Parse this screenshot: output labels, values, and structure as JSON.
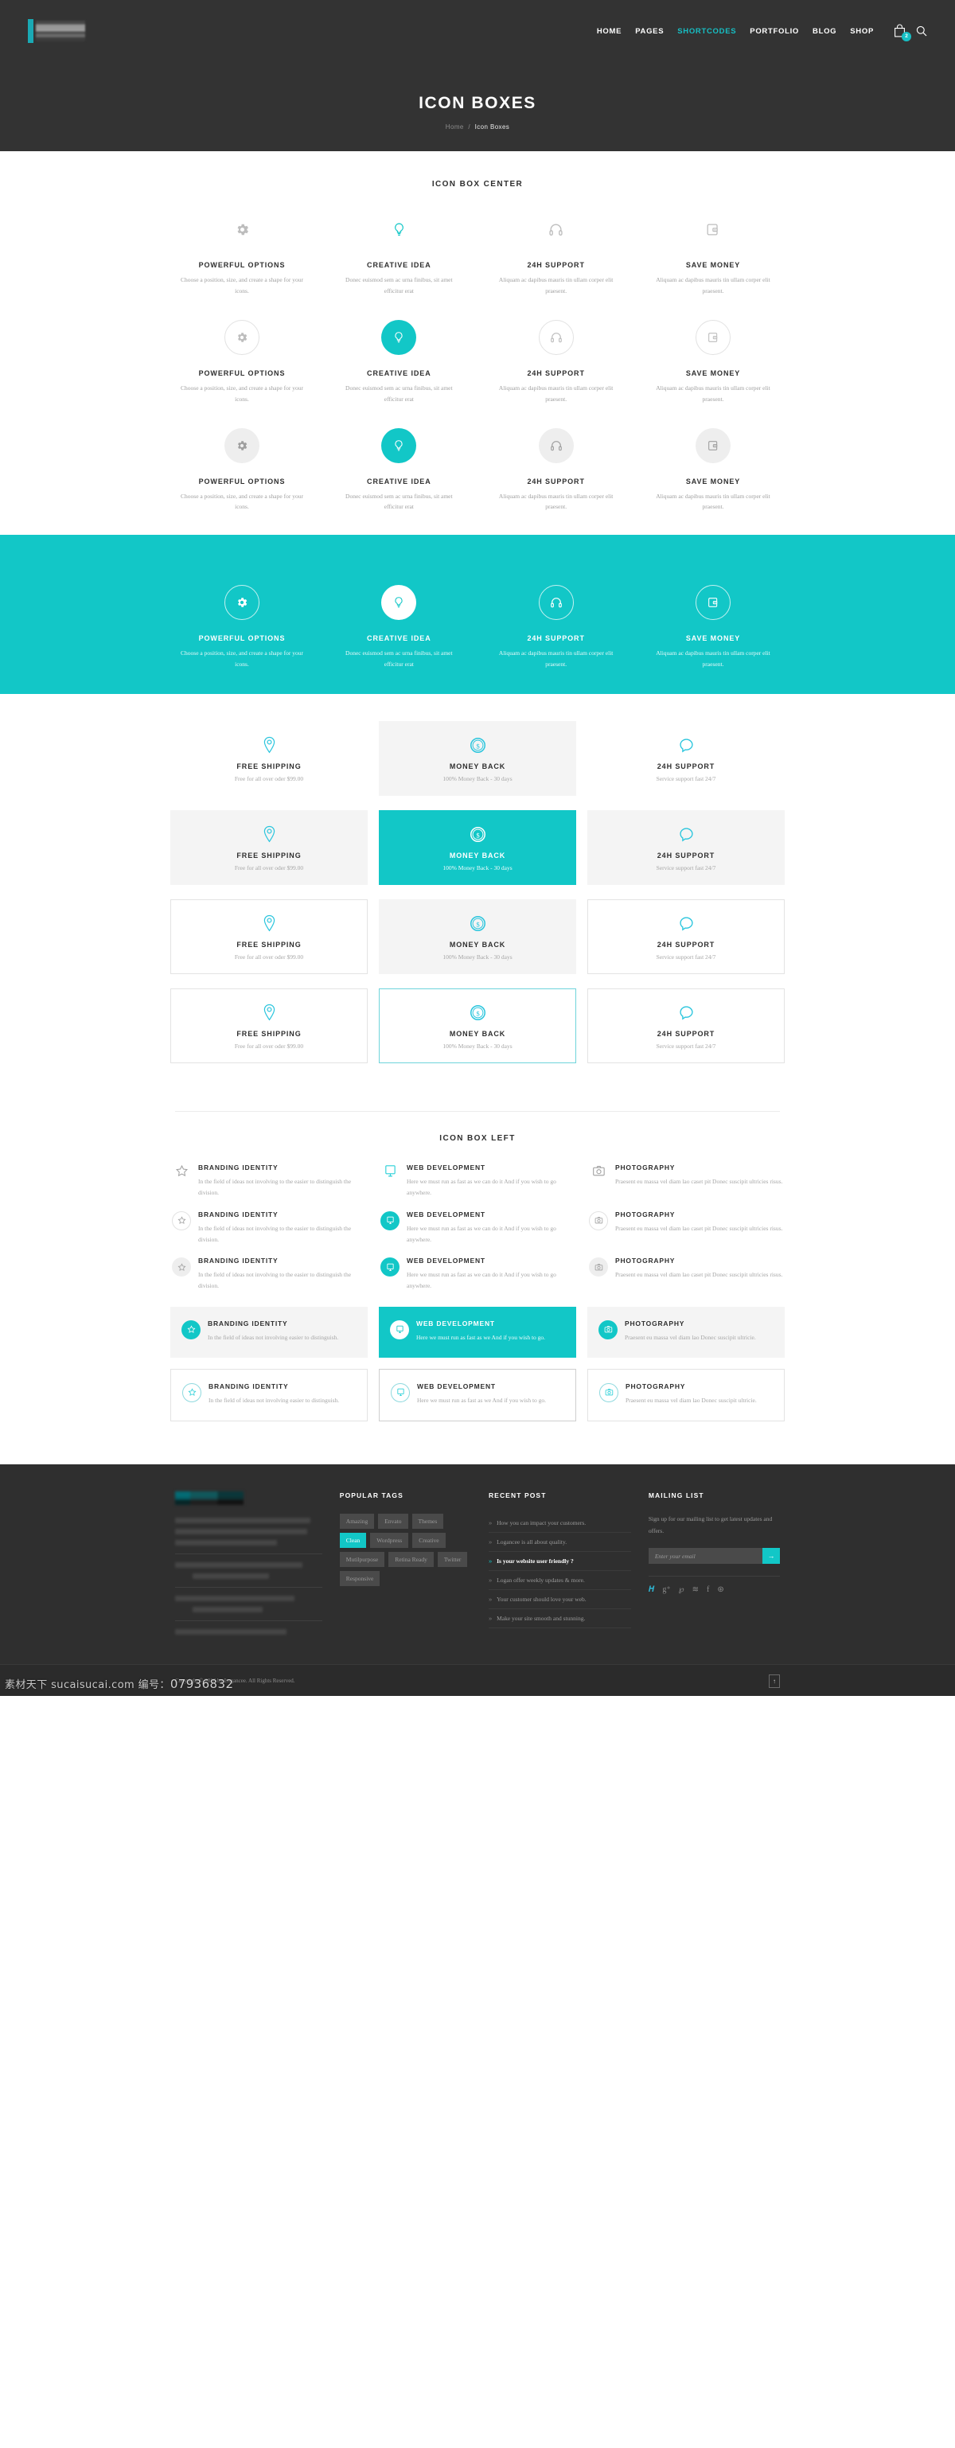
{
  "brand": {
    "accent": "#12c7c7",
    "dark": "#333333",
    "nav_active_color": "#17bfc4"
  },
  "header": {
    "nav": [
      {
        "label": "HOME",
        "active": false
      },
      {
        "label": "PAGES",
        "active": false
      },
      {
        "label": "SHORTCODES",
        "active": true
      },
      {
        "label": "PORTFOLIO",
        "active": false
      },
      {
        "label": "BLOG",
        "active": false
      },
      {
        "label": "SHOP",
        "active": false
      }
    ],
    "cart_count": "2",
    "title": "ICON BOXES",
    "breadcrumb_home": "Home",
    "breadcrumb_sep": "/",
    "breadcrumb_current": "Icon Boxes"
  },
  "center_section": {
    "title": "ICON BOX CENTER",
    "items": [
      {
        "icon": "gear-icon",
        "title": "POWERFUL OPTIONS",
        "desc": "Choose a position, size, and create a shape for your icons."
      },
      {
        "icon": "lightbulb-icon",
        "title": "CREATIVE IDEA",
        "desc": "Donec euismod sem ac urna finibus, sit amet efficitur erat"
      },
      {
        "icon": "headphones-icon",
        "title": "24H SUPPORT",
        "desc": "Aliquam ac dapibus mauris tin ullam corper elit praesent."
      },
      {
        "icon": "wallet-icon",
        "title": "SAVE MONEY",
        "desc": "Aliquam ac dapibus mauris tin ullam corper elit praesent."
      }
    ]
  },
  "features": {
    "items": [
      {
        "icon": "map-pin-icon",
        "title": "FREE SHIPPING",
        "desc": "Free for all over oder $99.00"
      },
      {
        "icon": "dollar-coin-icon",
        "title": "MONEY BACK",
        "desc": "100% Money Back - 30 days"
      },
      {
        "icon": "speech-bubble-icon",
        "title": "24H SUPPORT",
        "desc": "Service support fast 24/7"
      }
    ]
  },
  "left_section": {
    "title": "ICON BOX LEFT",
    "items": [
      {
        "icon": "star-icon",
        "title": "BRANDING IDENTITY",
        "desc": "In the field of ideas not involving to the easier to distinguish the division.",
        "desc_short": "In the field of ideas not involving easier to distinguish."
      },
      {
        "icon": "monitor-icon",
        "title": "WEB DEVELOPMENT",
        "desc": "Here we must run as fast as we can do it And if you wish to go anywhere.",
        "desc_short": "Here we must run as fast as we And if you wish to go."
      },
      {
        "icon": "camera-icon",
        "title": "PHOTOGRAPHY",
        "desc": "Praesent eu massa vel diam lao caset pit Donec suscipit ultricies risus.",
        "desc_short": "Praesent eu massa vel diam lao Donec suscipit ultricie."
      }
    ]
  },
  "footer": {
    "tags_title": "POPULAR TAGS",
    "tags": [
      {
        "label": "Amazing",
        "active": false
      },
      {
        "label": "Envato",
        "active": false
      },
      {
        "label": "Themes",
        "active": false
      },
      {
        "label": "Clean",
        "active": true
      },
      {
        "label": "Wordpress",
        "active": false
      },
      {
        "label": "Creative",
        "active": false
      },
      {
        "label": "Mutilpurpose",
        "active": false
      },
      {
        "label": "Retina Ready",
        "active": false
      },
      {
        "label": "Twitter",
        "active": false
      },
      {
        "label": "Responsive",
        "active": false
      }
    ],
    "recent_title": "RECENT POST",
    "recent_posts": [
      {
        "label": "How you can impact your customers.",
        "active": false
      },
      {
        "label": "Logancee is all about quality.",
        "active": false
      },
      {
        "label": "Is your website user friendly ?",
        "active": true
      },
      {
        "label": "Logan offer weekly updates & more.",
        "active": false
      },
      {
        "label": "Your customer should love your web.",
        "active": false
      },
      {
        "label": "Make your site smooth and stunning.",
        "active": false
      }
    ],
    "mail_title": "MAILING LIST",
    "mail_desc": "Sign up for our mailing list to get latest updates and offers.",
    "mail_placeholder": "Enter your email",
    "mail_value": "",
    "mail_submit": "→",
    "socials": [
      {
        "name": "twitter-icon",
        "glyph": "𝑯",
        "active": true
      },
      {
        "name": "google-plus-icon",
        "glyph": "g⁺",
        "active": false
      },
      {
        "name": "pinterest-icon",
        "glyph": "℘",
        "active": false
      },
      {
        "name": "rss-icon",
        "glyph": "≋",
        "active": false
      },
      {
        "name": "facebook-icon",
        "glyph": "f",
        "active": false
      },
      {
        "name": "dribbble-icon",
        "glyph": "⊛",
        "active": false
      }
    ],
    "copyright": "Copyright © 2016 by Logancee. All Rights Reserved.",
    "to_top": "↑"
  },
  "watermark": {
    "text": "素材天下 sucaisucai.com 编号：",
    "number": "07936832"
  }
}
